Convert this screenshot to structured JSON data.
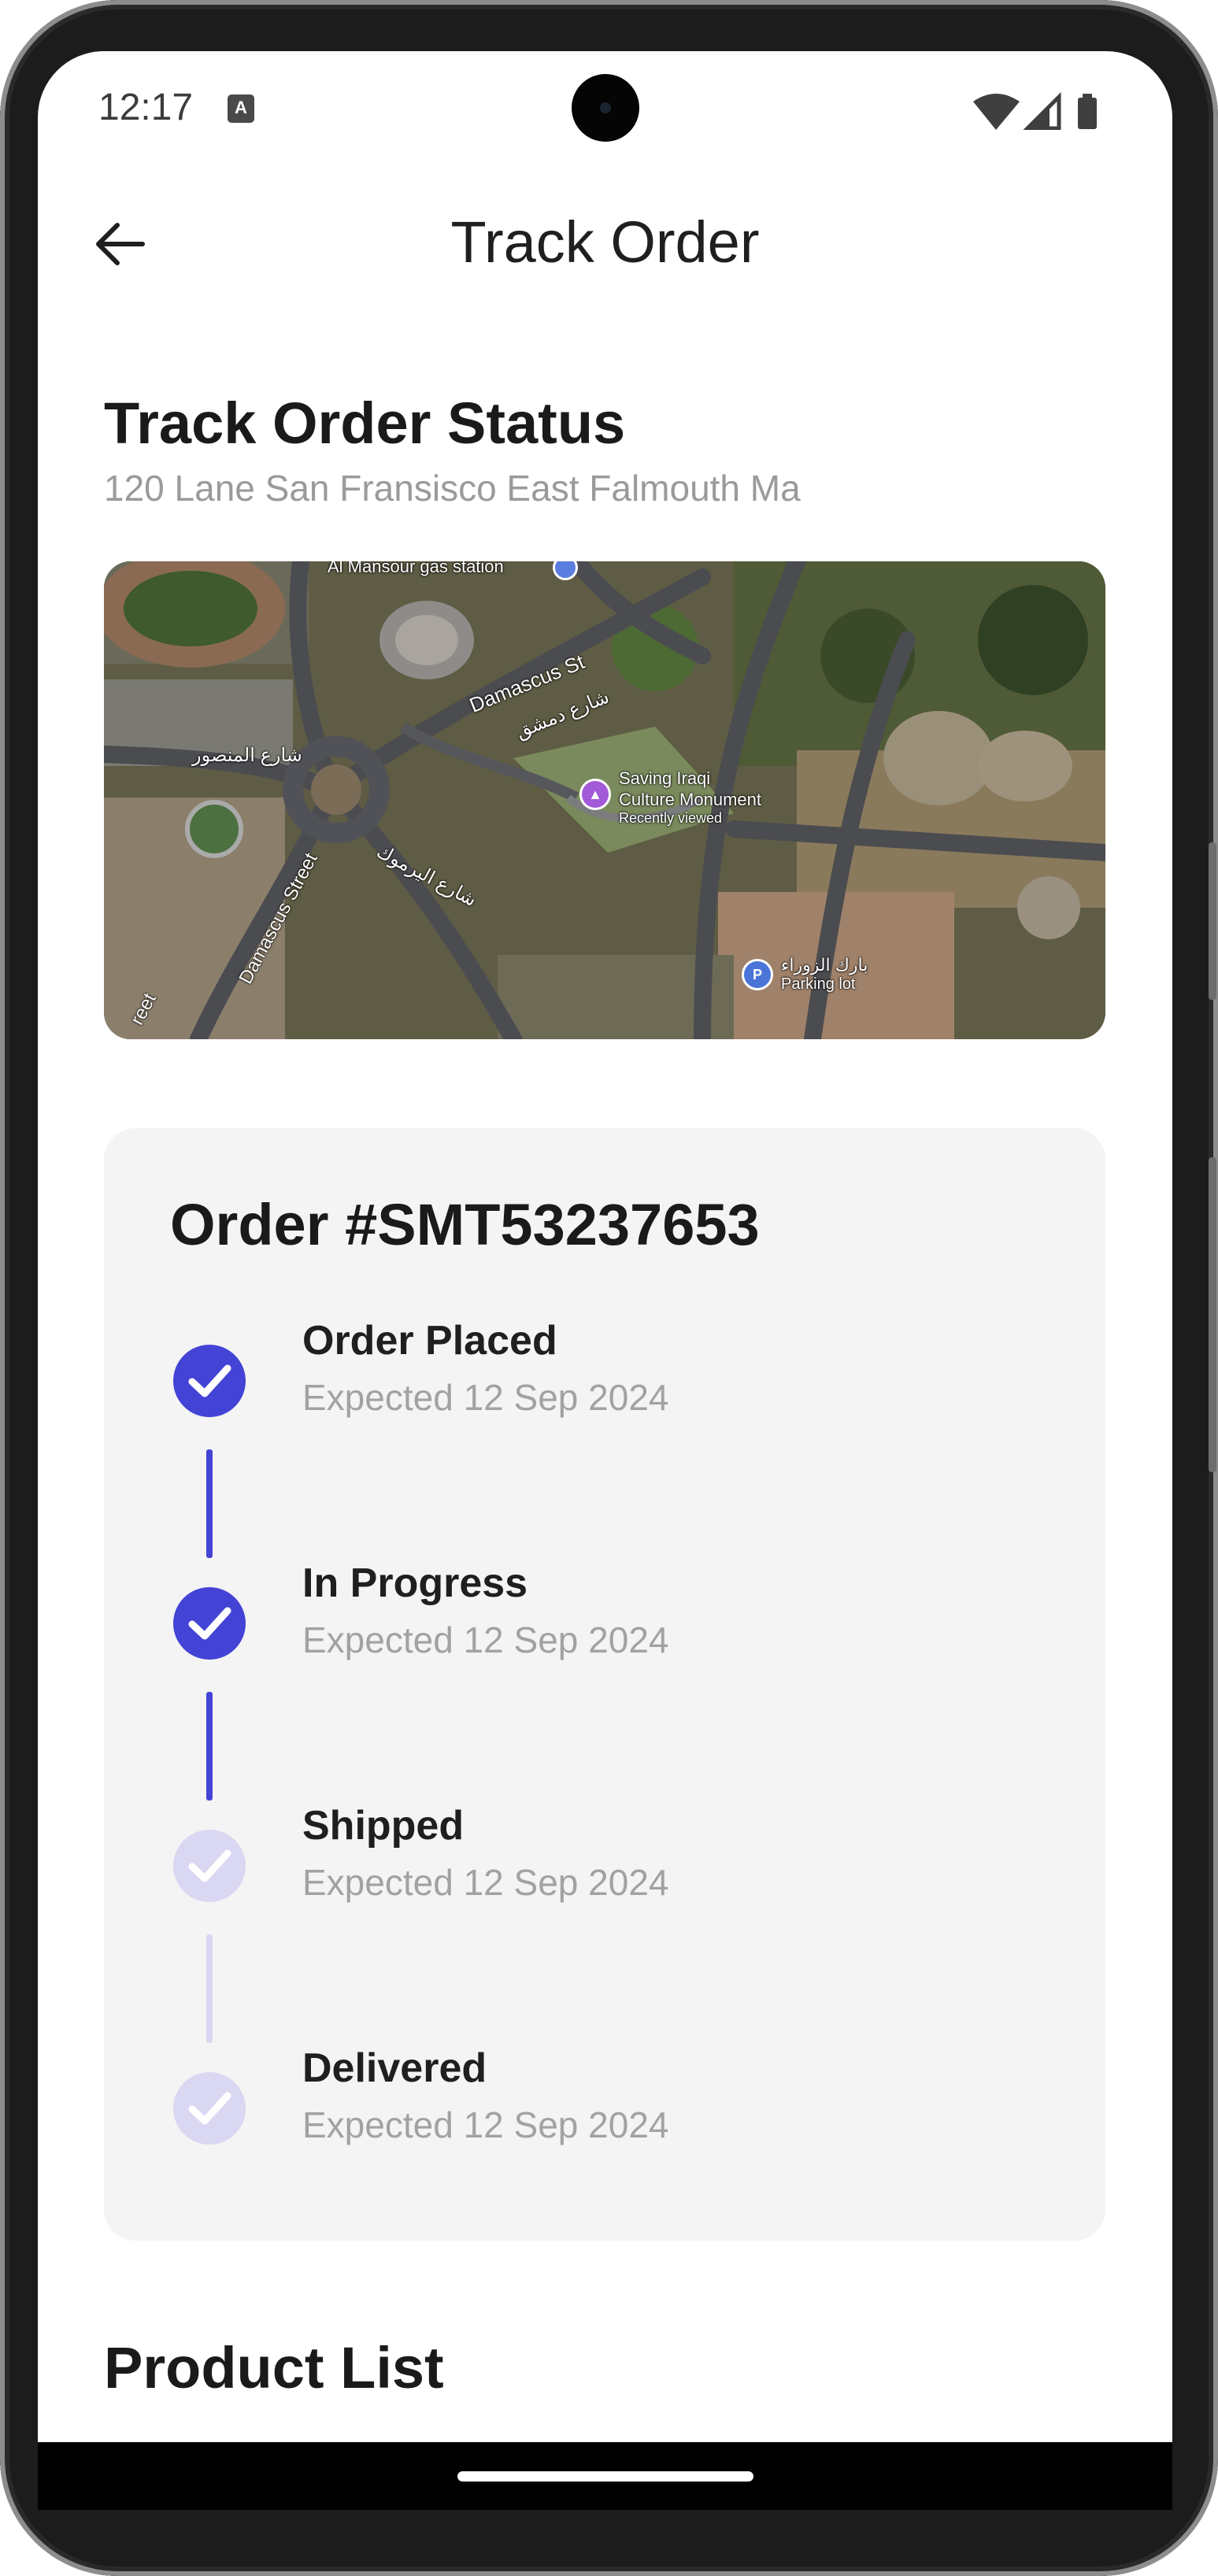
{
  "status_bar": {
    "time": "12:17",
    "notification_icon": "A"
  },
  "header": {
    "title": "Track Order",
    "back_icon": "arrow-left-icon"
  },
  "tracking": {
    "title": "Track Order Status",
    "address": "120 Lane San Fransisco East Falmouth Ma"
  },
  "map": {
    "labels": {
      "station": "Al Mansour gas station",
      "damascus_st": "Damascus St",
      "damascus_st_ar": "شارع دمشق",
      "mansour_ar": "شارع المنصور",
      "damascus_street": "Damascus Street",
      "yarmouk_ar": "شارع اليرموك",
      "monument": "Saving Iraqi",
      "monument2": "Culture Monument",
      "recent": "Recently viewed",
      "parking_ar": "بارك الزوراء",
      "parking": "Parking lot",
      "street_tail": "reet"
    }
  },
  "order": {
    "id_label": "Order #SMT53237653",
    "steps": [
      {
        "name": "Order Placed",
        "expected": "Expected 12 Sep 2024",
        "done": true
      },
      {
        "name": "In Progress",
        "expected": "Expected 12 Sep 2024",
        "done": true
      },
      {
        "name": "Shipped",
        "expected": "Expected 12 Sep 2024",
        "done": false
      },
      {
        "name": "Delivered",
        "expected": "Expected 12 Sep 2024",
        "done": false
      }
    ]
  },
  "product_list": {
    "title": "Product List"
  },
  "colors": {
    "accent": "#4343d6",
    "accent_light": "#d9d7f1",
    "card_bg": "#f4f4f4",
    "muted_text": "#9a9a9a"
  }
}
